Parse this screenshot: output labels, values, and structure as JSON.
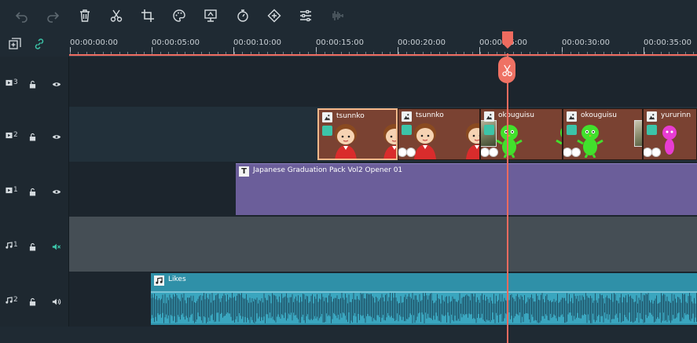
{
  "toolbar": {
    "buttons": [
      {
        "name": "undo",
        "icon": "undo-icon",
        "enabled": false
      },
      {
        "name": "redo",
        "icon": "redo-icon",
        "enabled": false
      },
      {
        "name": "delete",
        "icon": "trash-icon",
        "enabled": true
      },
      {
        "name": "cut",
        "icon": "scissors-icon",
        "enabled": true
      },
      {
        "name": "crop",
        "icon": "crop-icon",
        "enabled": true
      },
      {
        "name": "color",
        "icon": "palette-icon",
        "enabled": true
      },
      {
        "name": "green-screen",
        "icon": "screen-icon",
        "enabled": true
      },
      {
        "name": "speed",
        "icon": "stopwatch-icon",
        "enabled": true
      },
      {
        "name": "keyframe",
        "icon": "diamond-icon",
        "enabled": true
      },
      {
        "name": "adjust",
        "icon": "sliders-icon",
        "enabled": true
      },
      {
        "name": "audio",
        "icon": "waveform-icon",
        "enabled": false
      }
    ]
  },
  "ruler": {
    "timecodes": [
      "00:00:00:00",
      "00:00:05:00",
      "00:00:10:00",
      "00:00:15:00",
      "00:00:20:00",
      "00:00:25:00",
      "00:00:30:00",
      "00:00:35:00"
    ]
  },
  "tracks": [
    {
      "kind": "video",
      "number": "3",
      "visibility": "eye-icon"
    },
    {
      "kind": "video",
      "number": "2",
      "visibility": "eye-icon"
    },
    {
      "kind": "video",
      "number": "1",
      "visibility": "eye-icon"
    },
    {
      "kind": "audio",
      "number": "1",
      "visibility": "speaker-muted-icon"
    },
    {
      "kind": "audio",
      "number": "2",
      "visibility": "speaker-icon"
    }
  ],
  "clips": {
    "v2": [
      {
        "label": "tsunnko",
        "selected": true
      },
      {
        "label": "tsunnko",
        "selected": false
      },
      {
        "label": "okouguisu",
        "selected": false
      },
      {
        "label": "okouguisu",
        "selected": false
      },
      {
        "label": "yururinn",
        "selected": false
      }
    ],
    "v1": {
      "label": "Japanese Graduation Pack Vol2 Opener 01"
    },
    "a2": {
      "label": "Likes"
    }
  },
  "colors": {
    "playhead": "#ee6b5f",
    "title_clip": "#6b5e9a",
    "audio_clip": "#2f90a8",
    "image_clip": "#7a4232",
    "selection": "#f5b98b"
  }
}
